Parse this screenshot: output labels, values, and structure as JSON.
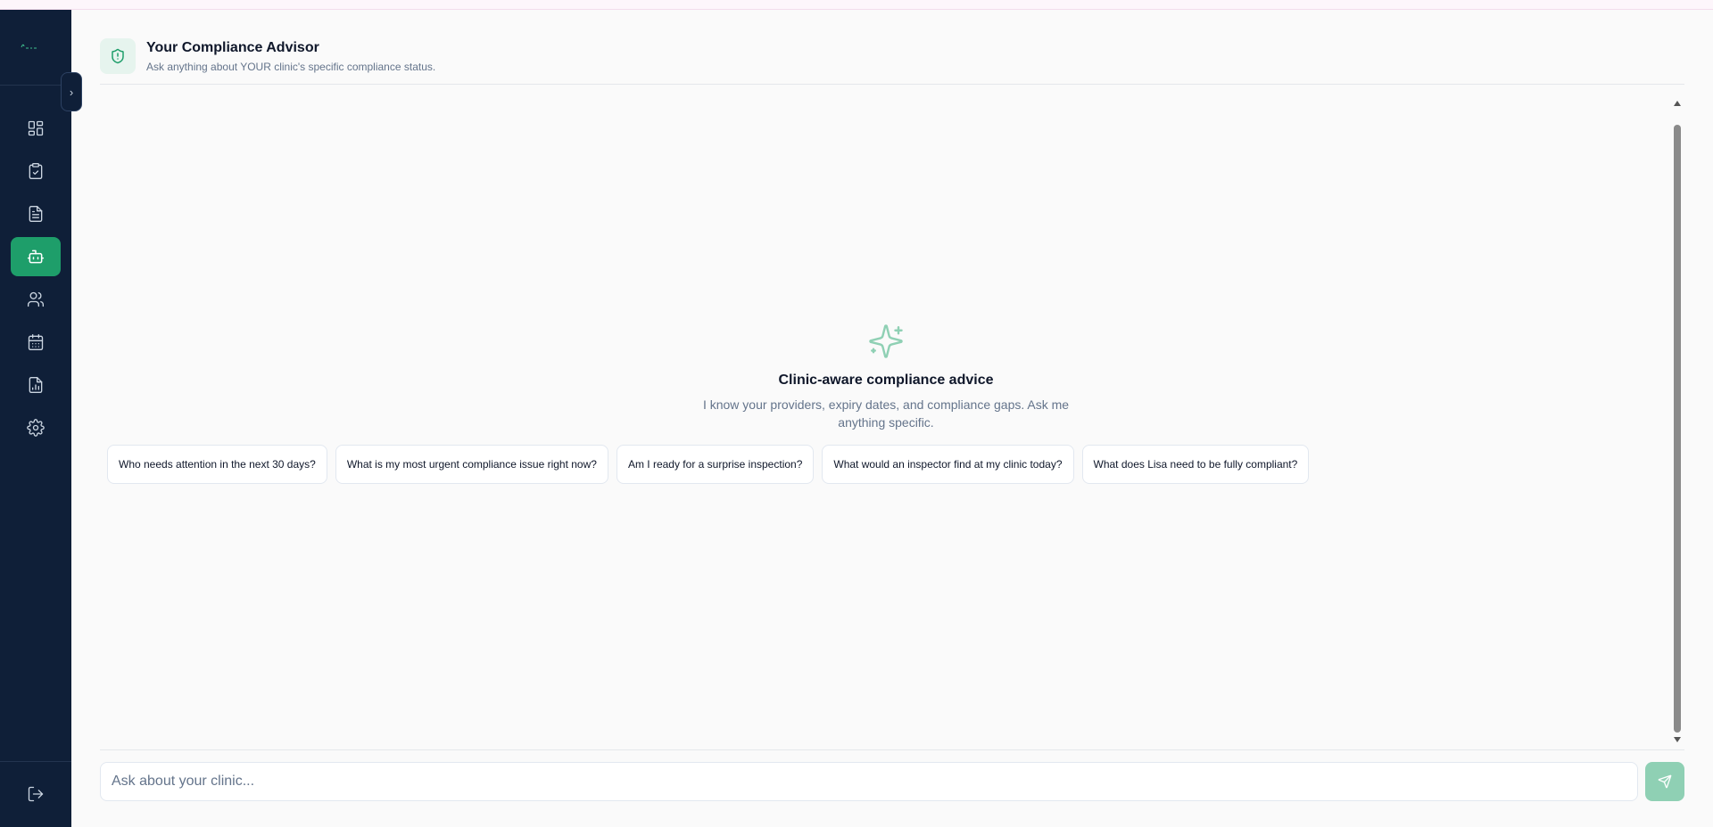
{
  "header": {
    "title": "Your Compliance Advisor",
    "subtitle": "Ask anything about YOUR clinic's specific compliance status.",
    "icon": "shield-alert-icon"
  },
  "sidebar": {
    "collapse_icon": "›",
    "items": [
      {
        "name": "dashboard",
        "icon": "layout-grid-icon",
        "active": false
      },
      {
        "name": "checklist",
        "icon": "clipboard-check-icon",
        "active": false
      },
      {
        "name": "documents",
        "icon": "file-text-icon",
        "active": false
      },
      {
        "name": "advisor",
        "icon": "bot-icon",
        "active": true
      },
      {
        "name": "team",
        "icon": "users-icon",
        "active": false
      },
      {
        "name": "calendar",
        "icon": "calendar-icon",
        "active": false
      },
      {
        "name": "reports",
        "icon": "file-chart-icon",
        "active": false
      },
      {
        "name": "settings",
        "icon": "gear-icon",
        "active": false
      }
    ],
    "logout_icon": "log-out-icon"
  },
  "empty_state": {
    "icon": "sparkles-icon",
    "title": "Clinic-aware compliance advice",
    "description": "I know your providers, expiry dates, and compliance gaps. Ask me anything specific."
  },
  "suggestions": [
    "Who needs attention in the next 30 days?",
    "What is my most urgent compliance issue right now?",
    "Am I ready for a surprise inspection?",
    "What would an inspector find at my clinic today?",
    "What does Lisa need to be fully compliant?"
  ],
  "input": {
    "placeholder": "Ask about your clinic...",
    "value": ""
  },
  "colors": {
    "sidebar_bg": "#0f1f38",
    "accent": "#1e9e6a",
    "send_button": "#8fd0b4"
  }
}
